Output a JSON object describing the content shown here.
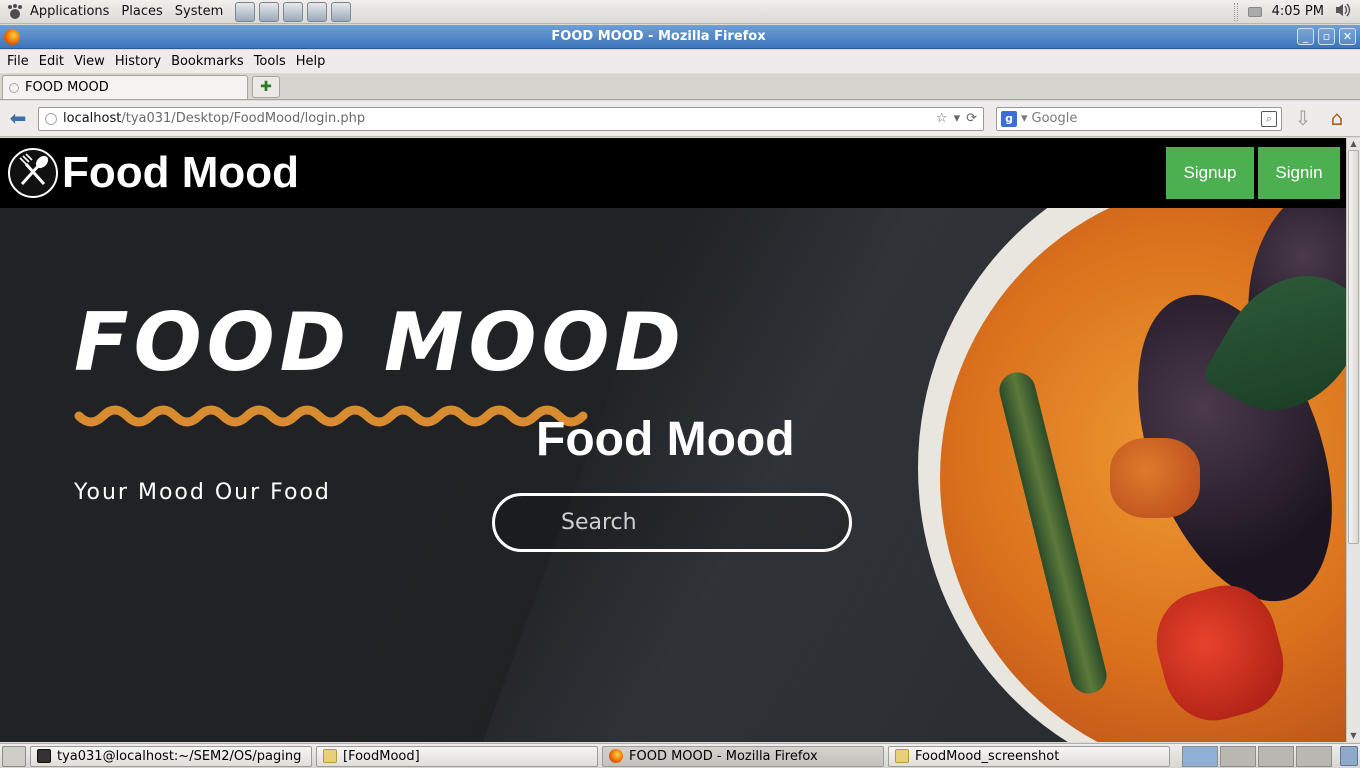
{
  "desktop": {
    "menus": [
      "Applications",
      "Places",
      "System"
    ],
    "clock": "4:05 PM"
  },
  "window": {
    "title": "FOOD MOOD - Mozilla Firefox"
  },
  "browser": {
    "menu": [
      "File",
      "Edit",
      "View",
      "History",
      "Bookmarks",
      "Tools",
      "Help"
    ],
    "tab_title": "FOOD MOOD",
    "url_host": "localhost",
    "url_path": "/tya031/Desktop/FoodMood/login.php",
    "search_engine_placeholder": "Google"
  },
  "page": {
    "brand": "Food Mood",
    "buttons": {
      "signup": "Signup",
      "signin": "Signin"
    },
    "hero_title": "FOOD MOOD",
    "tagline": "Your Mood Our Food",
    "hero_subtitle": "Food Mood",
    "search_placeholder": "Search",
    "accent_color": "#4caf50",
    "squiggle_color": "#d98c2f"
  },
  "taskbar": {
    "tasks": [
      {
        "label": "tya031@localhost:~/SEM2/OS/paging",
        "icon": "terminal-icon"
      },
      {
        "label": "[FoodMood]",
        "icon": "folder-icon"
      },
      {
        "label": "FOOD MOOD - Mozilla Firefox",
        "icon": "firefox-icon"
      },
      {
        "label": "FoodMood_screenshot",
        "icon": "folder-icon"
      }
    ]
  }
}
